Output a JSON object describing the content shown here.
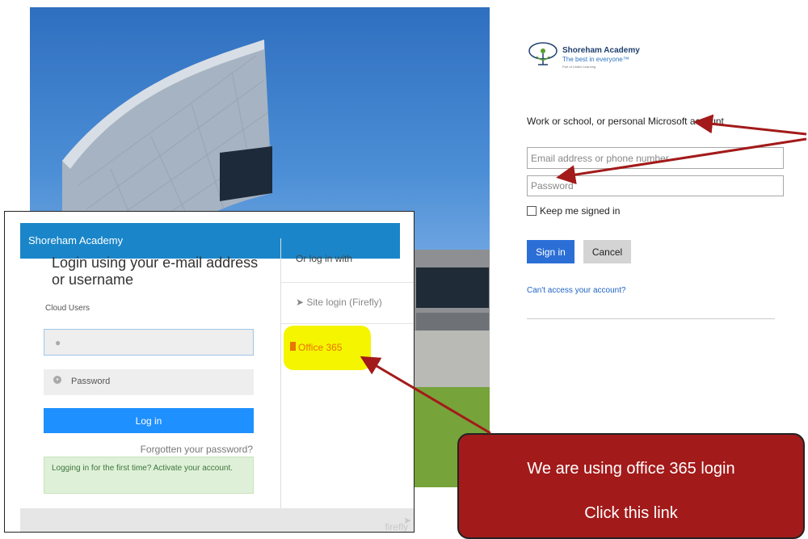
{
  "microsoft": {
    "logo_title": "Shoreham Academy",
    "logo_tagline": "The best in everyone™",
    "logo_small": "Part of United Learning",
    "account_label": "Work or school, or personal Microsoft account",
    "email_placeholder": "Email address or phone number",
    "password_placeholder": "Password",
    "keep_signed_in": "Keep me signed in",
    "sign_in": "Sign in",
    "cancel": "Cancel",
    "cant_access": "Can't access your account?"
  },
  "firefly": {
    "header": "Shoreham Academy",
    "title": "Login using your e-mail address or username",
    "cloud_users": "Cloud Users",
    "password_placeholder": "Password",
    "login_button": "Log in",
    "forgotten": "Forgotten your password?",
    "first_time": "Logging in for the first time? Activate your account.",
    "or_log_in_with": "Or log in with",
    "site_login": "Site login (Firefly)",
    "office365": "Office 365",
    "footer_logo": "firefly"
  },
  "callout": {
    "line1": "We are using office 365 login",
    "line2": "Click this link"
  },
  "colors": {
    "firefly_header": "#1a86c9",
    "login_button": "#1e90ff",
    "ms_sign_in": "#2b6fd6",
    "highlight": "#f5f500",
    "callout_bg": "#a31a1a",
    "arrow": "#a31a1a"
  }
}
